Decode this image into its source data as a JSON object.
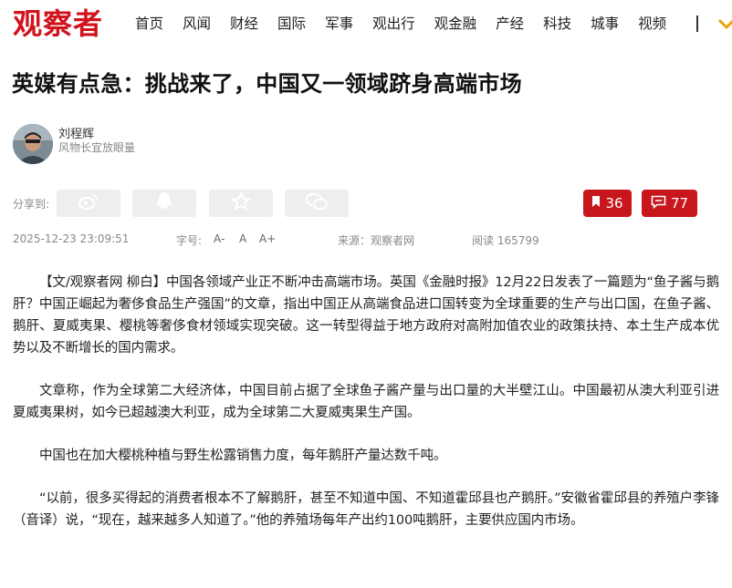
{
  "header": {
    "logo": "观察者",
    "nav": [
      "首页",
      "风闻",
      "财经",
      "国际",
      "军事",
      "观出行",
      "观金融",
      "产经",
      "科技",
      "城事",
      "视频"
    ]
  },
  "article": {
    "title": "英媒有点急：挑战来了，中国又一领域跻身高端市场",
    "author": {
      "name": "刘程辉",
      "desc": "风物长宜放眼量"
    },
    "share_label": "分享到:",
    "share_icons": [
      "weibo-icon",
      "qq-icon",
      "star-icon",
      "wechat-icon"
    ],
    "bookmark_count": "36",
    "comment_count": "77",
    "meta": {
      "datetime": "2025-12-23 23:09:51",
      "font_label": "字号:",
      "font_sizes": [
        "A-",
        "A",
        "A+"
      ],
      "source": "来源：观察者网",
      "views": "阅读 165799"
    },
    "paragraphs": [
      "【文/观察者网 柳白】中国各领域产业正不断冲击高端市场。英国《金融时报》12月22日发表了一篇题为“鱼子酱与鹅肝？中国正崛起为奢侈食品生产强国”的文章，指出中国正从高端食品进口国转变为全球重要的生产与出口国，在鱼子酱、鹅肝、夏威夷果、樱桃等奢侈食材领域实现突破。这一转型得益于地方政府对高附加值农业的政策扶持、本土生产成本优势以及不断增长的国内需求。",
      "文章称，作为全球第二大经济体，中国目前占据了全球鱼子酱产量与出口量的大半壁江山。中国最初从澳大利亚引进夏威夷果树，如今已超越澳大利亚，成为全球第二大夏威夷果生产国。",
      "中国也在加大樱桃种植与野生松露销售力度，每年鹅肝产量达数千吨。",
      "“以前，很多买得起的消费者根本不了解鹅肝，甚至不知道中国、不知道霍邱县也产鹅肝。”安徽省霍邱县的养殖户李锋（音译）说，“现在，越来越多人知道了。”他的养殖场每年产出约100吨鹅肝，主要供应国内市场。"
    ]
  },
  "colors": {
    "brand_red": "#d0131d",
    "button_red": "#c8161d",
    "share_bg": "#eeeeee"
  }
}
